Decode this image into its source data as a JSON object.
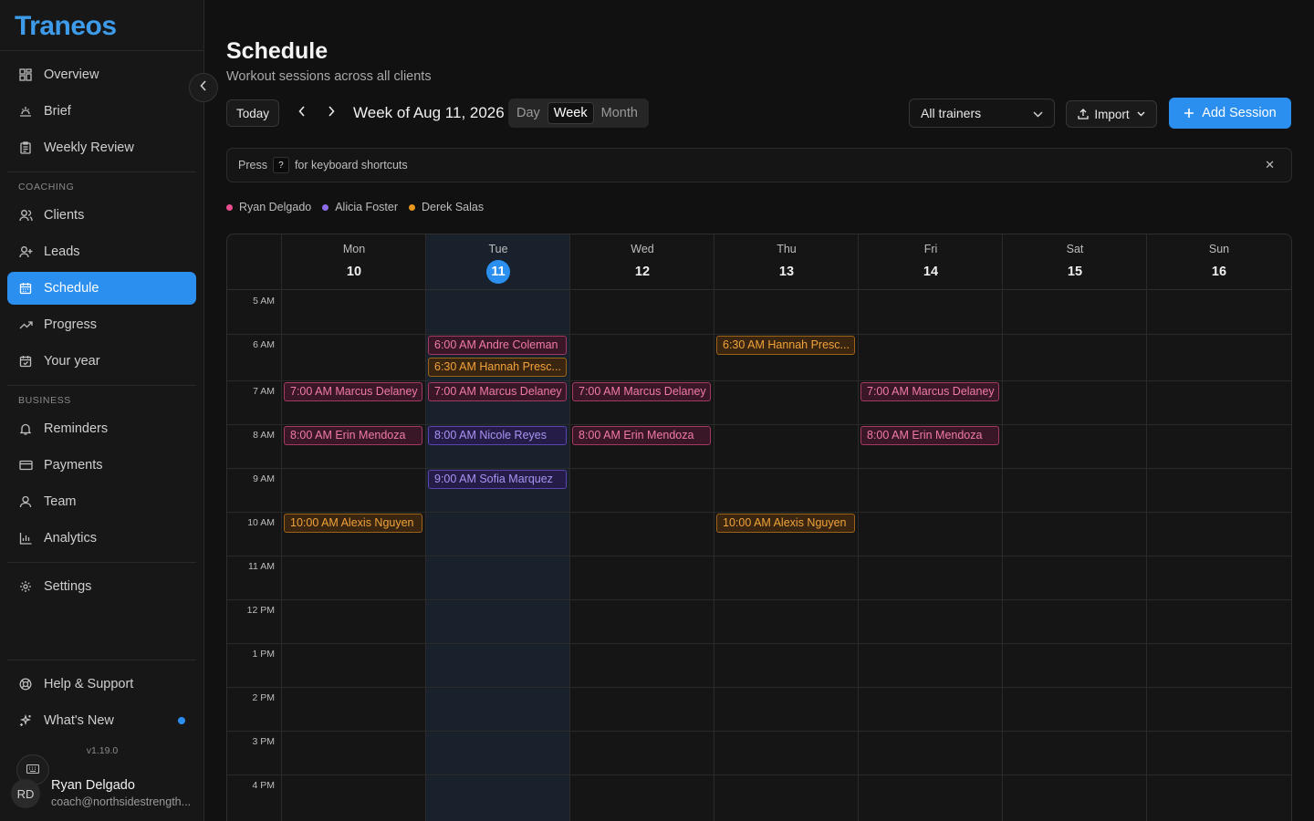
{
  "app": {
    "logo": "Traneos"
  },
  "colors": {
    "accent": "#2b8ff0",
    "ryan": "#e84f8c",
    "alicia": "#8b6ee6",
    "derek": "#e8971f"
  },
  "sidebar": {
    "top_items": [
      {
        "label": "Overview",
        "icon": "grid-icon"
      },
      {
        "label": "Brief",
        "icon": "sunrise-icon"
      },
      {
        "label": "Weekly Review",
        "icon": "clipboard-icon"
      }
    ],
    "coaching_label": "COACHING",
    "coaching_items": [
      {
        "label": "Clients",
        "icon": "users-icon"
      },
      {
        "label": "Leads",
        "icon": "user-plus-icon"
      },
      {
        "label": "Schedule",
        "icon": "calendar-icon",
        "active": true
      },
      {
        "label": "Progress",
        "icon": "trending-up-icon"
      },
      {
        "label": "Your year",
        "icon": "calendar-check-icon"
      }
    ],
    "business_label": "BUSINESS",
    "business_items": [
      {
        "label": "Reminders",
        "icon": "bell-icon"
      },
      {
        "label": "Payments",
        "icon": "credit-card-icon"
      },
      {
        "label": "Team",
        "icon": "team-icon"
      },
      {
        "label": "Analytics",
        "icon": "bar-chart-icon"
      }
    ],
    "settings_label": "Settings",
    "help_label": "Help & Support",
    "whats_new_label": "What's New",
    "version": "v1.19.0",
    "user": {
      "initials": "RD",
      "name": "Ryan Delgado",
      "email": "coach@northsidestrength..."
    }
  },
  "header": {
    "title": "Schedule",
    "subtitle": "Workout sessions across all clients",
    "today_label": "Today",
    "week_label": "Week of Aug 11, 2026",
    "views": [
      "Day",
      "Week",
      "Month"
    ],
    "active_view": "Week",
    "trainer_filter": "All trainers",
    "import_label": "Import",
    "add_label": "Add Session"
  },
  "shortcut_bar": {
    "prefix": "Press",
    "key": "?",
    "suffix": "for keyboard shortcuts"
  },
  "legend": [
    {
      "name": "Ryan Delgado",
      "color": "#e84f8c"
    },
    {
      "name": "Alicia Foster",
      "color": "#8b6ee6"
    },
    {
      "name": "Derek Salas",
      "color": "#e8971f"
    }
  ],
  "calendar": {
    "days": [
      {
        "dow": "Mon",
        "num": "10"
      },
      {
        "dow": "Tue",
        "num": "11",
        "today": true
      },
      {
        "dow": "Wed",
        "num": "12"
      },
      {
        "dow": "Thu",
        "num": "13"
      },
      {
        "dow": "Fri",
        "num": "14"
      },
      {
        "dow": "Sat",
        "num": "15"
      },
      {
        "dow": "Sun",
        "num": "16"
      }
    ],
    "hours": [
      "5 AM",
      "6 AM",
      "7 AM",
      "8 AM",
      "9 AM",
      "10 AM",
      "11 AM",
      "12 PM",
      "1 PM",
      "2 PM",
      "3 PM",
      "4 PM"
    ],
    "events": [
      {
        "day": 1,
        "hour": 1,
        "slot": 0,
        "label": "6:00 AM Andre Coleman",
        "trainer": "pink"
      },
      {
        "day": 1,
        "hour": 1,
        "slot": 1,
        "label": "6:30 AM Hannah Presc...",
        "trainer": "orange"
      },
      {
        "day": 3,
        "hour": 1,
        "slot": 0,
        "label": "6:30 AM Hannah Presc...",
        "trainer": "orange"
      },
      {
        "day": 0,
        "hour": 2,
        "slot": 0,
        "label": "7:00 AM Marcus Delaney",
        "trainer": "pink"
      },
      {
        "day": 1,
        "hour": 2,
        "slot": 0,
        "label": "7:00 AM Marcus Delaney",
        "trainer": "pink"
      },
      {
        "day": 2,
        "hour": 2,
        "slot": 0,
        "label": "7:00 AM Marcus Delaney",
        "trainer": "pink"
      },
      {
        "day": 4,
        "hour": 2,
        "slot": 0,
        "label": "7:00 AM Marcus Delaney",
        "trainer": "pink"
      },
      {
        "day": 0,
        "hour": 3,
        "slot": 0,
        "label": "8:00 AM Erin Mendoza",
        "trainer": "pink"
      },
      {
        "day": 1,
        "hour": 3,
        "slot": 0,
        "label": "8:00 AM Nicole Reyes",
        "trainer": "purple"
      },
      {
        "day": 2,
        "hour": 3,
        "slot": 0,
        "label": "8:00 AM Erin Mendoza",
        "trainer": "pink"
      },
      {
        "day": 4,
        "hour": 3,
        "slot": 0,
        "label": "8:00 AM Erin Mendoza",
        "trainer": "pink"
      },
      {
        "day": 1,
        "hour": 4,
        "slot": 0,
        "label": "9:00 AM Sofia Marquez",
        "trainer": "purple"
      },
      {
        "day": 0,
        "hour": 5,
        "slot": 0,
        "label": "10:00 AM Alexis Nguyen",
        "trainer": "orange"
      },
      {
        "day": 3,
        "hour": 5,
        "slot": 0,
        "label": "10:00 AM Alexis Nguyen",
        "trainer": "orange"
      }
    ]
  }
}
